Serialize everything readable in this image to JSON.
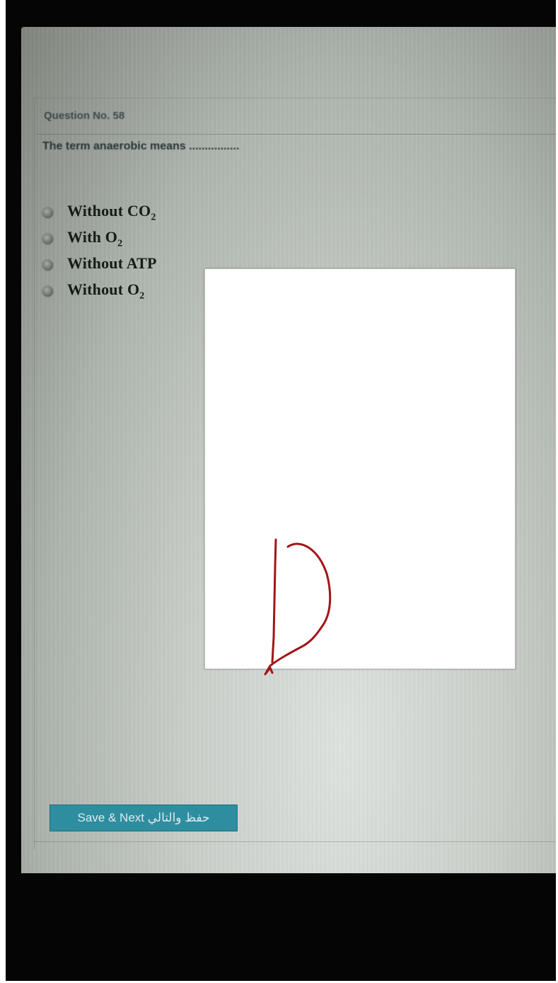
{
  "question": {
    "number": "Question No. 58",
    "text": "The term anaerobic means ................"
  },
  "options": [
    {
      "label": "Without CO",
      "sub": "2"
    },
    {
      "label": "With O",
      "sub": "2"
    },
    {
      "label": "Without ATP",
      "sub": ""
    },
    {
      "label": "Without O",
      "sub": "2"
    }
  ],
  "save_button": {
    "label": "Save & Next حفظ والتالي"
  },
  "annotation": {
    "handwritten_answer": "D",
    "ink_color": "#a31419"
  },
  "colors": {
    "button_bg": "#2e8ea0",
    "frame": "#050505"
  }
}
